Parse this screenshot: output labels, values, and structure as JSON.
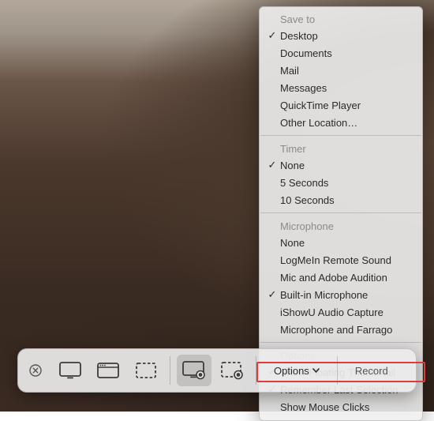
{
  "toolbar": {
    "options_label": "Options",
    "record_label": "Record",
    "buttons": {
      "close": "close",
      "capture_entire": "capture-entire-screen",
      "capture_window": "capture-selected-window",
      "capture_selection": "capture-selected-portion",
      "record_entire": "record-entire-screen",
      "record_selection": "record-selected-portion"
    },
    "selected": "record_entire"
  },
  "menu": {
    "sections": [
      {
        "header": "Save to",
        "items": [
          {
            "label": "Desktop",
            "checked": true
          },
          {
            "label": "Documents",
            "checked": false
          },
          {
            "label": "Mail",
            "checked": false
          },
          {
            "label": "Messages",
            "checked": false
          },
          {
            "label": "QuickTime Player",
            "checked": false
          },
          {
            "label": "Other Location…",
            "checked": false
          }
        ]
      },
      {
        "header": "Timer",
        "items": [
          {
            "label": "None",
            "checked": true
          },
          {
            "label": "5 Seconds",
            "checked": false
          },
          {
            "label": "10 Seconds",
            "checked": false
          }
        ]
      },
      {
        "header": "Microphone",
        "items": [
          {
            "label": "None",
            "checked": false
          },
          {
            "label": "LogMeIn Remote Sound",
            "checked": false
          },
          {
            "label": "Mic and Adobe Audition",
            "checked": false
          },
          {
            "label": "Built-in Microphone",
            "checked": true
          },
          {
            "label": "iShowU Audio Capture",
            "checked": false
          },
          {
            "label": "Microphone and Farrago",
            "checked": false
          }
        ]
      },
      {
        "header": "Options",
        "items": [
          {
            "label": "Show Floating Thumbnail",
            "checked": true,
            "highlighted": true
          },
          {
            "label": "Remember Last Selection",
            "checked": true
          },
          {
            "label": "Show Mouse Clicks",
            "checked": false
          }
        ]
      }
    ]
  }
}
